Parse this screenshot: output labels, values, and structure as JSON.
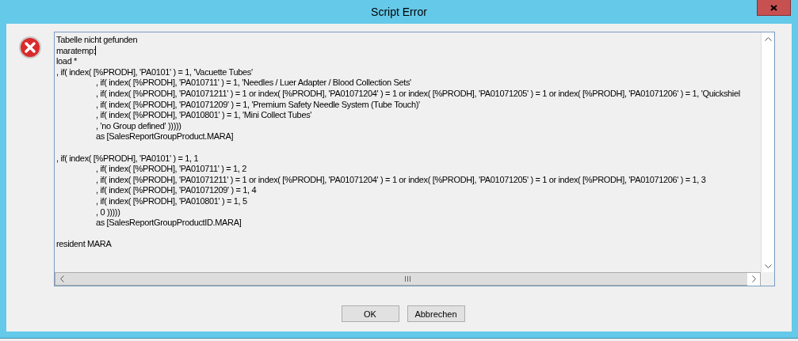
{
  "window": {
    "title": "Script Error"
  },
  "script_text": {
    "paragraphs": [
      [
        {
          "text": "Tabelle nicht gefunden",
          "indented": false,
          "cursor": false
        },
        {
          "text": "maratemp:",
          "indented": false,
          "cursor": true
        },
        {
          "text": "load *",
          "indented": false,
          "cursor": false
        },
        {
          "text": ", if( index( [%PRODH], 'PA0101' ) = 1, 'Vacuette Tubes'",
          "indented": false,
          "cursor": false
        },
        {
          "text": ", if( index( [%PRODH], 'PA010711' ) = 1, 'Needles / Luer Adapter / Blood Collection Sets'",
          "indented": true,
          "cursor": false
        },
        {
          "text": ", if( index( [%PRODH], 'PA01071211' ) = 1 or index( [%PRODH], 'PA01071204' ) = 1 or index( [%PRODH], 'PA01071205' ) = 1 or index( [%PRODH], 'PA01071206' ) = 1, 'Quickshiel",
          "indented": true,
          "cursor": false
        },
        {
          "text": ", if( index( [%PRODH], 'PA01071209' ) = 1, 'Premium Safety Needle System (Tube Touch)'",
          "indented": true,
          "cursor": false
        },
        {
          "text": ", if( index( [%PRODH], 'PA010801' ) = 1, 'Mini Collect Tubes'",
          "indented": true,
          "cursor": false
        },
        {
          "text": ", 'no Group defined' )))))",
          "indented": true,
          "cursor": false
        },
        {
          "text": "as [SalesReportGroupProduct.MARA]",
          "indented": true,
          "cursor": false
        }
      ],
      [
        {
          "text": ", if( index( [%PRODH], 'PA0101' ) = 1, 1",
          "indented": false,
          "cursor": false
        },
        {
          "text": ", if( index( [%PRODH], 'PA010711' ) = 1, 2",
          "indented": true,
          "cursor": false
        },
        {
          "text": ", if( index( [%PRODH], 'PA01071211' ) = 1 or index( [%PRODH], 'PA01071204' ) = 1 or index( [%PRODH], 'PA01071205' ) = 1 or index( [%PRODH], 'PA01071206' ) = 1, 3",
          "indented": true,
          "cursor": false
        },
        {
          "text": ", if( index( [%PRODH], 'PA01071209' ) = 1, 4",
          "indented": true,
          "cursor": false
        },
        {
          "text": ", if( index( [%PRODH], 'PA010801' ) = 1, 5",
          "indented": true,
          "cursor": false
        },
        {
          "text": ", 0 )))))",
          "indented": true,
          "cursor": false
        },
        {
          "text": "as [SalesReportGroupProductID.MARA]",
          "indented": true,
          "cursor": false
        }
      ],
      [
        {
          "text": "resident MARA",
          "indented": false,
          "cursor": false
        }
      ]
    ]
  },
  "buttons": [
    {
      "label": "OK"
    },
    {
      "label": "Abbrechen"
    }
  ]
}
